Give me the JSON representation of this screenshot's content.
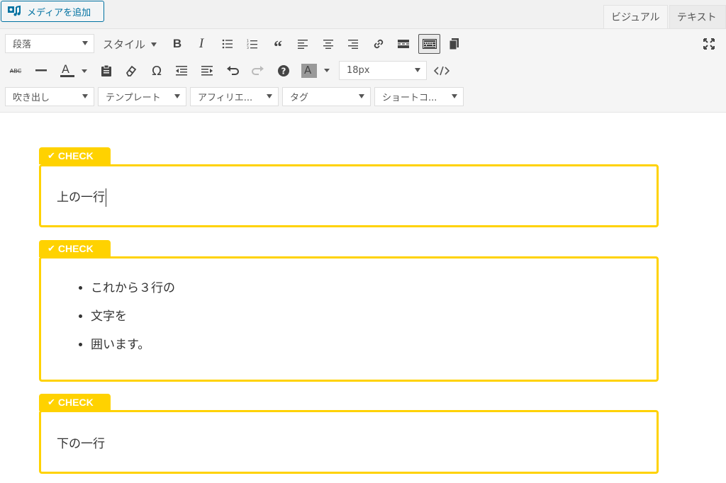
{
  "topbar": {
    "add_media_label": "メディアを追加",
    "tabs": [
      {
        "label": "ビジュアル",
        "active": true
      },
      {
        "label": "テキスト",
        "active": false
      }
    ]
  },
  "toolbar": {
    "row1": {
      "paragraph_select": "段落",
      "style_label": "スタイル"
    },
    "row2": {
      "font_size": "18px"
    },
    "row3": {
      "selects": [
        "吹き出し",
        "テンプレート",
        "アフィリエ...",
        "タグ",
        "ショートコ..."
      ]
    }
  },
  "content": {
    "boxes": [
      {
        "label": "CHECK",
        "text": "上の一行"
      },
      {
        "label": "CHECK",
        "items": [
          "これから３行の",
          "文字を",
          "囲います。"
        ]
      },
      {
        "label": "CHECK",
        "text": "下の一行"
      }
    ]
  },
  "colors": {
    "accent": "#ffd200",
    "link": "#0071a1"
  }
}
